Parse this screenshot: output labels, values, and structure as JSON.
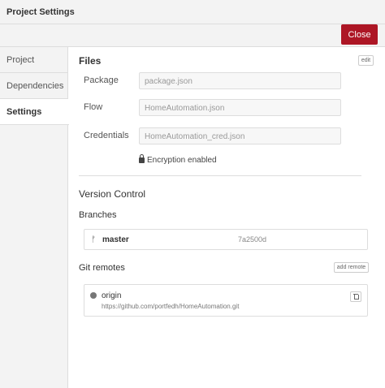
{
  "window": {
    "title": "Project Settings"
  },
  "toolbar": {
    "close_label": "Close"
  },
  "sidebar": {
    "items": [
      {
        "label": "Project",
        "active": false
      },
      {
        "label": "Dependencies",
        "active": false
      },
      {
        "label": "Settings",
        "active": true
      }
    ]
  },
  "files": {
    "heading": "Files",
    "edit_label": "edit",
    "fields": [
      {
        "label": "Package",
        "value": "package.json"
      },
      {
        "label": "Flow",
        "value": "HomeAutomation.json"
      },
      {
        "label": "Credentials",
        "value": "HomeAutomation_cred.json"
      }
    ],
    "encryption_status": "Encryption enabled"
  },
  "version_control": {
    "heading": "Version Control",
    "branches_heading": "Branches",
    "branch": {
      "icon": "branch-icon",
      "name": "master",
      "hash": "7a2500d"
    },
    "remotes_heading": "Git remotes",
    "add_remote_label": "add remote",
    "remote": {
      "icon": "globe-icon",
      "name": "origin",
      "url": "https://github.com/portfedh/HomeAutomation.git"
    }
  },
  "colors": {
    "accent": "#ad1625",
    "sidebar_bg": "#f3f3f3",
    "border": "#dddddd"
  }
}
